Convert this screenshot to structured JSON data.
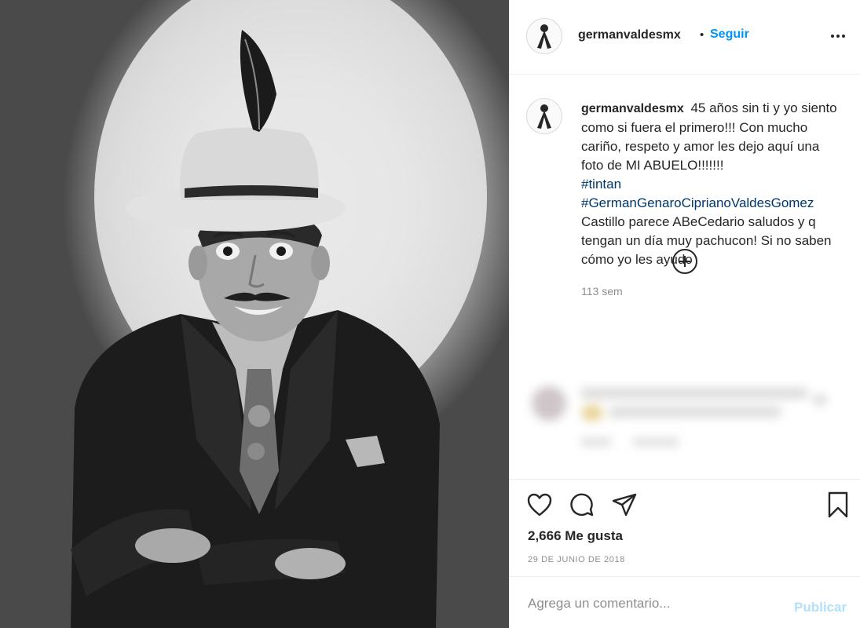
{
  "photo": {
    "icon": "post-photo",
    "subject": "black-and-white portrait"
  },
  "header": {
    "username": "germanvaldesmx",
    "separator": "•",
    "follow_label": "Seguir",
    "more_icon": "ellipsis-icon"
  },
  "caption": {
    "username": "germanvaldesmx",
    "text_before": "45 años sin ti y yo siento como si fuera el primero!!! Con mucho cariño, respeto y amor les dejo aquí una foto de MI ABUELO!!!!!!!",
    "hashtag_1": "#tintan",
    "hashtag_2": "#GermanGenaroCiprianoValdesGomez",
    "text_after": "Castillo parece ABeCedario saludos y q tengan un día muy pachucon! Si no saben cómo yo les ayudo",
    "time": "113 sem"
  },
  "load_more_icon": "plus-circle-icon",
  "actions": {
    "like_icon": "heart-icon",
    "comment_icon": "comment-icon",
    "share_icon": "paper-plane-icon",
    "save_icon": "bookmark-icon"
  },
  "likes": "2,666 Me gusta",
  "date": "29 DE JUNIO DE 2018",
  "comment": {
    "placeholder": "Agrega un comentario...",
    "value": "",
    "publish_label": "Publicar"
  },
  "colors": {
    "link_blue": "#0095f6",
    "hashtag_blue": "#00376b",
    "publish_disabled": "#b2dffc",
    "muted_text": "#8e8e8e"
  }
}
